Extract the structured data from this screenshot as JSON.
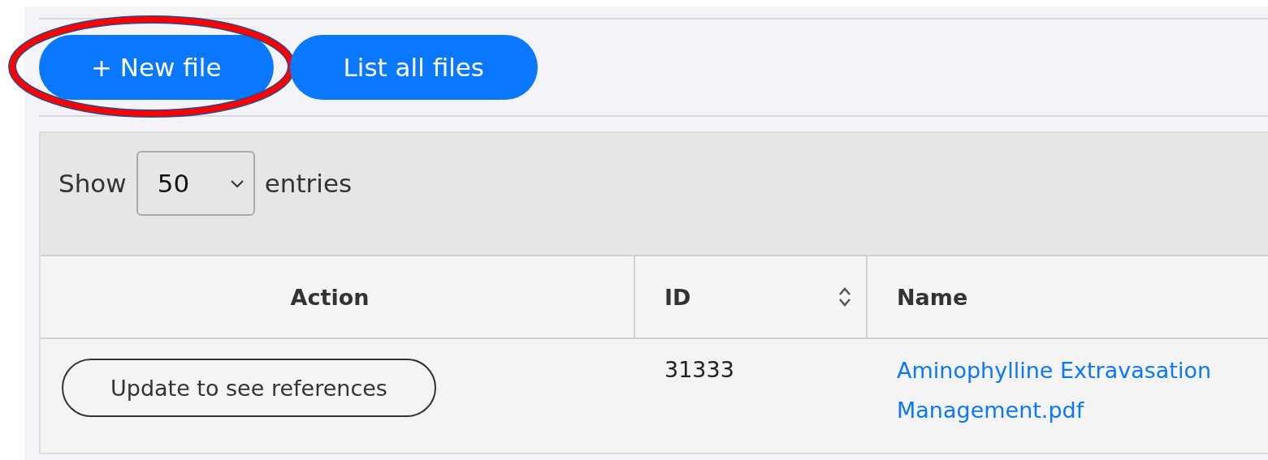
{
  "toolbar": {
    "buttons": [
      {
        "label": "+ New file",
        "highlighted": true
      },
      {
        "label": "List all files",
        "highlighted": false
      }
    ]
  },
  "table": {
    "length_menu": {
      "prefix": "Show",
      "value": "50",
      "suffix": "entries"
    },
    "columns": [
      {
        "label": "Action",
        "sortable": false
      },
      {
        "label": "ID",
        "sortable": true
      },
      {
        "label": "Name",
        "sortable": false
      }
    ],
    "rows": [
      {
        "action": "Update to see references",
        "id": "31333",
        "name": "Aminophylline Extravasation Management.pdf"
      }
    ]
  }
}
